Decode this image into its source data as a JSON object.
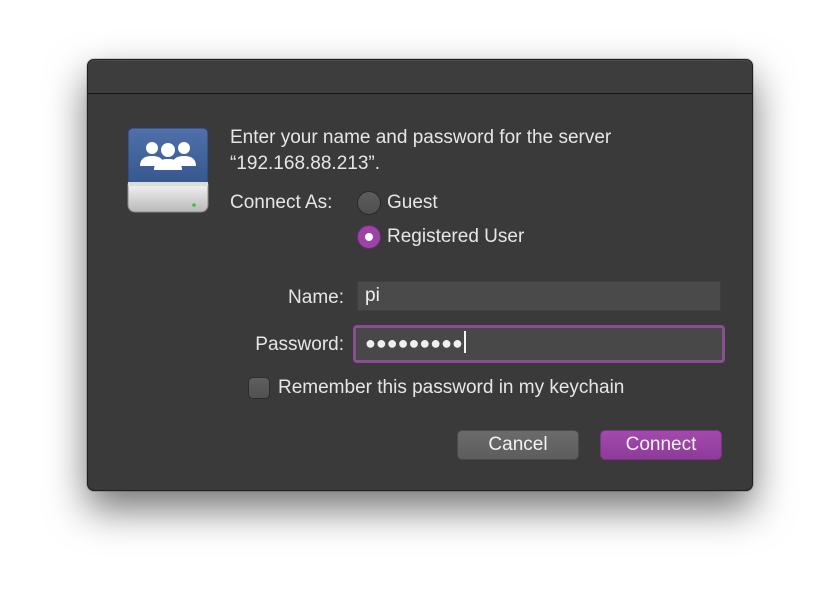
{
  "dialog": {
    "prompt_line1": "Enter your name and password for the server",
    "prompt_line2": "“192.168.88.213”.",
    "server_icon": "network-server-icon"
  },
  "connect_as": {
    "label": "Connect As:",
    "options": [
      {
        "label": "Guest",
        "selected": false
      },
      {
        "label": "Registered User",
        "selected": true
      }
    ]
  },
  "name_field": {
    "label": "Name:",
    "value": "pi"
  },
  "password_field": {
    "label": "Password:",
    "value": "●●●●●●●●●",
    "focused": true
  },
  "remember": {
    "label": "Remember this password in my keychain",
    "checked": false
  },
  "buttons": {
    "cancel": "Cancel",
    "connect": "Connect"
  },
  "colors": {
    "accent": "#9b44a6",
    "dialog_bg": "#3a3a3a",
    "field_bg": "#4a4a4a",
    "focus_ring": "#8a4e92"
  }
}
